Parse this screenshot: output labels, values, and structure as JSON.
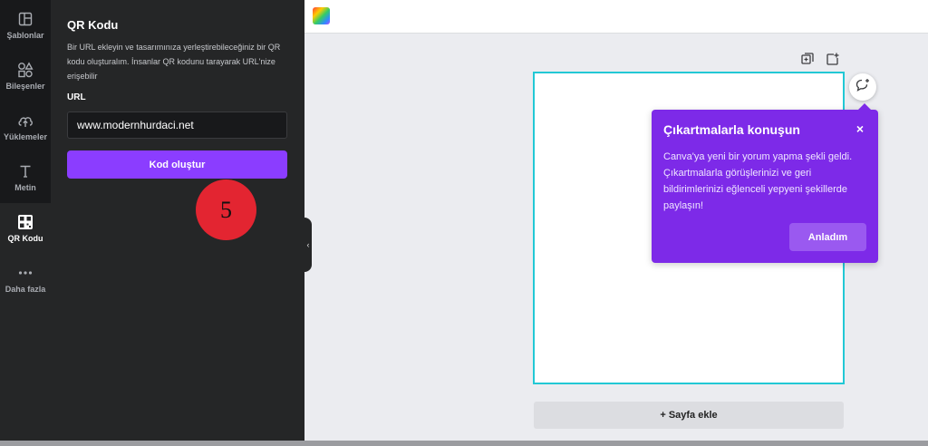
{
  "sidebar": {
    "items": [
      {
        "label": "Şablonlar",
        "icon": "layout-icon"
      },
      {
        "label": "Bileşenler",
        "icon": "shapes-icon"
      },
      {
        "label": "Yüklemeler",
        "icon": "cloud-upload-icon"
      },
      {
        "label": "Metin",
        "icon": "text-icon"
      },
      {
        "label": "QR Kodu",
        "icon": "qr-code-icon",
        "active": true
      },
      {
        "label": "Daha fazla",
        "icon": "more-icon"
      }
    ]
  },
  "panel": {
    "title": "QR Kodu",
    "description": "Bir URL ekleyin ve tasarımınıza yerleştirebileceğiniz bir QR kodu oluşturalım. İnsanlar QR kodunu tarayarak URL'nize erişebilir",
    "url_label": "URL",
    "url_value": "www.modernhurdaci.net",
    "create_button": "Kod oluştur",
    "step_number": "5"
  },
  "popover": {
    "title": "Çıkartmalarla konuşun",
    "close": "×",
    "body": "Canva'ya yeni bir yorum yapma şekli geldi. Çıkartmalarla görüşlerinizi ve geri bildirimlerinizi eğlenceli yepyeni şekillerde paylaşın!",
    "button": "Anladım"
  },
  "canvas": {
    "add_page": "+ Sayfa ekle"
  },
  "colors": {
    "accent": "#8b3dff",
    "popover": "#7d2ae8",
    "page_border": "#22c8d5",
    "step_badge": "#e32531"
  }
}
